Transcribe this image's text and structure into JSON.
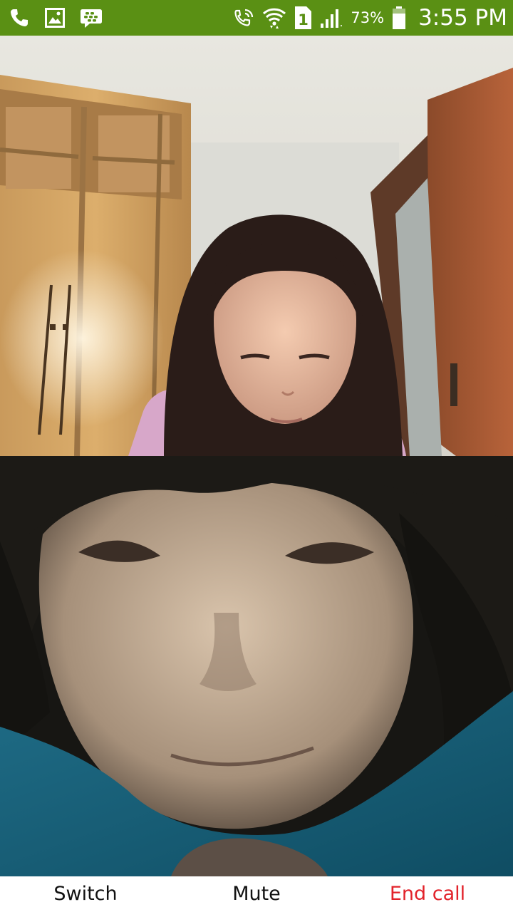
{
  "status_bar": {
    "battery_percent": "73%",
    "time": "3:55 PM",
    "sim_slot": "1",
    "background_color": "#5a9014",
    "left_icons": [
      "phone-icon",
      "gallery-icon",
      "bbm-icon"
    ],
    "right_icons": [
      "wifi-calling-icon",
      "wifi-icon",
      "sim-icon",
      "signal-icon",
      "battery-icon"
    ]
  },
  "call": {
    "remote_feed": "remote-participant-video",
    "local_feed": "self-camera-preview"
  },
  "controls": {
    "switch_label": "Switch",
    "mute_label": "Mute",
    "end_call_label": "End call",
    "end_call_color": "#e2222a"
  }
}
